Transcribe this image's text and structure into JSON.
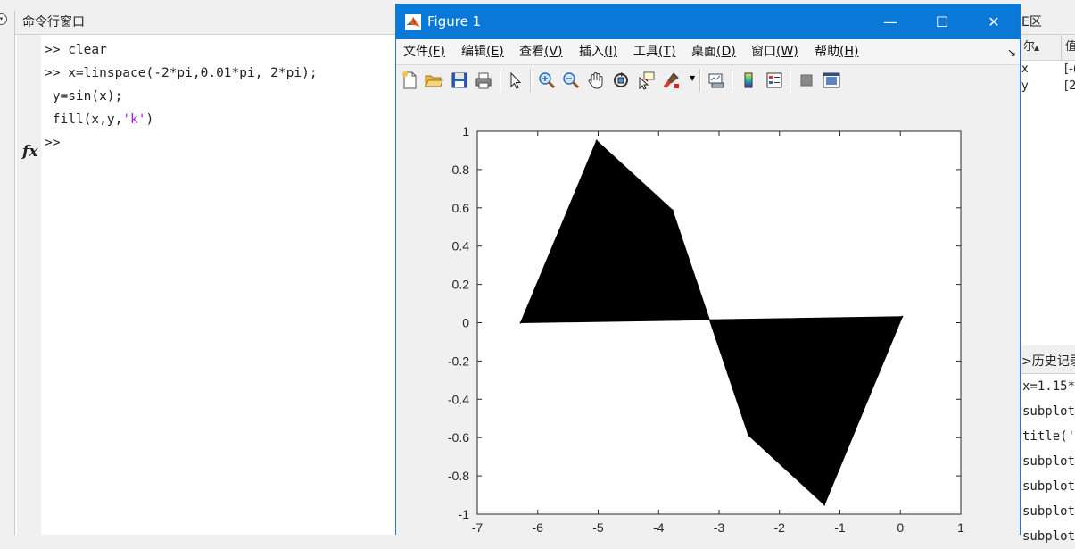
{
  "matlab": {
    "command_window": {
      "title": "命令行窗口",
      "lines": [
        {
          "prompt": ">> ",
          "code": "clear"
        },
        {
          "prompt": ">> ",
          "code": "x=linspace(-2*pi,0.01*pi, 2*pi);"
        },
        {
          "prompt": " ",
          "code": "y=sin(x);"
        },
        {
          "prompt": " ",
          "code": "fill(x,y,"
        },
        {
          "prompt": ">> ",
          "code": ""
        }
      ],
      "fill_string": "'k'",
      "fill_close": ")",
      "fx_icon": "fx",
      "string_color": "#a020f0"
    },
    "workspace": {
      "title_fragment": "E区",
      "col_name_fragment": "尔",
      "col_value_fragment": "值",
      "rows": [
        {
          "name": "x",
          "value": "[-("
        },
        {
          "name": "y",
          "value": "[2."
        }
      ]
    },
    "history": {
      "title_fragment": "历史记录",
      "lines": [
        "x=1.15*",
        "subplot",
        "title('",
        "subplot",
        "subplot",
        "subplot",
        "subplot"
      ]
    }
  },
  "figure": {
    "title": "Figure 1",
    "window_buttons": {
      "minimize": "—",
      "maximize": "☐",
      "close": "✕"
    },
    "menus": [
      {
        "label": "文件",
        "key": "(F)"
      },
      {
        "label": "编辑",
        "key": "(E)"
      },
      {
        "label": "查看",
        "key": "(V)"
      },
      {
        "label": "插入",
        "key": "(I)"
      },
      {
        "label": "工具",
        "key": "(T)"
      },
      {
        "label": "桌面",
        "key": "(D)"
      },
      {
        "label": "窗口",
        "key": "(W)"
      },
      {
        "label": "帮助",
        "key": "(H)"
      }
    ],
    "toolbar_icons": [
      "new-figure-icon",
      "open-file-icon",
      "save-icon",
      "print-icon",
      "edit-plot-arrow-icon",
      "zoom-in-icon",
      "zoom-out-icon",
      "pan-hand-icon",
      "rotate-3d-icon",
      "data-cursor-icon",
      "brush-icon",
      "brush-dropdown-icon",
      "link-plot-icon",
      "colorbar-icon",
      "legend-icon",
      "hide-plot-tools-icon",
      "show-plot-tools-icon"
    ]
  },
  "chart_data": {
    "type": "area",
    "title": "",
    "xlabel": "",
    "ylabel": "",
    "xlim": [
      -7,
      1
    ],
    "ylim": [
      -1,
      1
    ],
    "xticks": [
      "-7",
      "-6",
      "-5",
      "-4",
      "-3",
      "-2",
      "-1",
      "0",
      "1"
    ],
    "yticks": [
      "1",
      "0.8",
      "0.6",
      "0.4",
      "0.2",
      "0",
      "-0.2",
      "-0.4",
      "-0.6",
      "-0.8",
      "-1"
    ],
    "grid": false,
    "fill_color": "#000000",
    "x": [
      -6.2832,
      -5.0265,
      -3.7699,
      -2.5133,
      -1.2566,
      0.0314
    ],
    "y": [
      0.0,
      0.9511,
      0.5878,
      -0.5878,
      -0.9511,
      0.0314
    ]
  }
}
